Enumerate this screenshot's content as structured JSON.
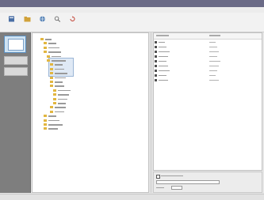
{
  "window": {
    "title": ""
  },
  "menu": [],
  "toolbar": [
    {
      "name": "toolbar-button-1",
      "icon": "document-icon",
      "color": "#4a6fa5"
    },
    {
      "name": "toolbar-button-2",
      "icon": "folder-icon",
      "color": "#d1a23a"
    },
    {
      "name": "toolbar-button-3",
      "icon": "globe-icon",
      "color": "#5b86b8"
    },
    {
      "name": "toolbar-button-4",
      "icon": "search-icon",
      "color": "#6a6a6a"
    },
    {
      "name": "toolbar-button-5",
      "icon": "refresh-icon",
      "color": "#c0392b"
    }
  ],
  "sidebar": {
    "buttons": [
      "",
      ""
    ]
  },
  "tree": {
    "rows": 22
  },
  "list": {
    "rows": 9
  },
  "bottom": {
    "checkbox_label": "",
    "field_value": ""
  },
  "status": {
    "text": ""
  },
  "colors": {
    "titlebar": "#6a6a86",
    "folder": "#e2b640",
    "selection": "#dfe9f5"
  }
}
